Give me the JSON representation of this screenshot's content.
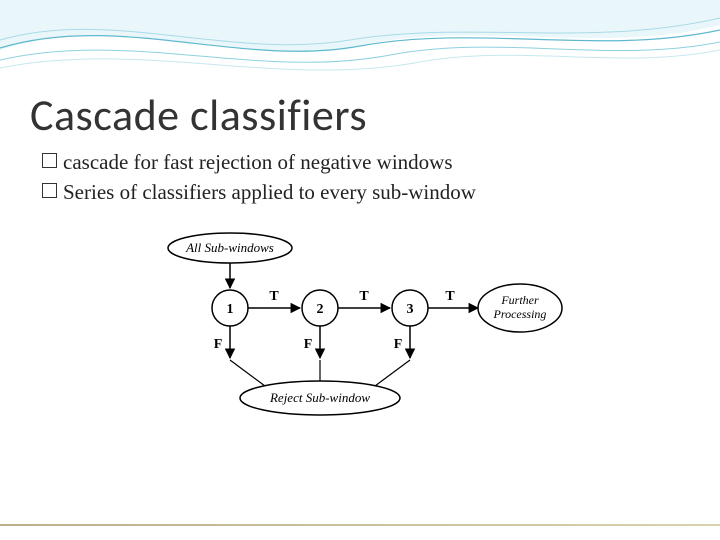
{
  "title": "Cascade classifiers",
  "bullets": [
    "cascade for fast rejection of negative windows",
    "Series of classifiers applied to every sub-window"
  ],
  "diagram": {
    "input_label": "All Sub-windows",
    "nodes": [
      "1",
      "2",
      "3"
    ],
    "pass_label": "T",
    "fail_label": "F",
    "output_label": "Further\nProcessing",
    "reject_label": "Reject Sub-window"
  }
}
